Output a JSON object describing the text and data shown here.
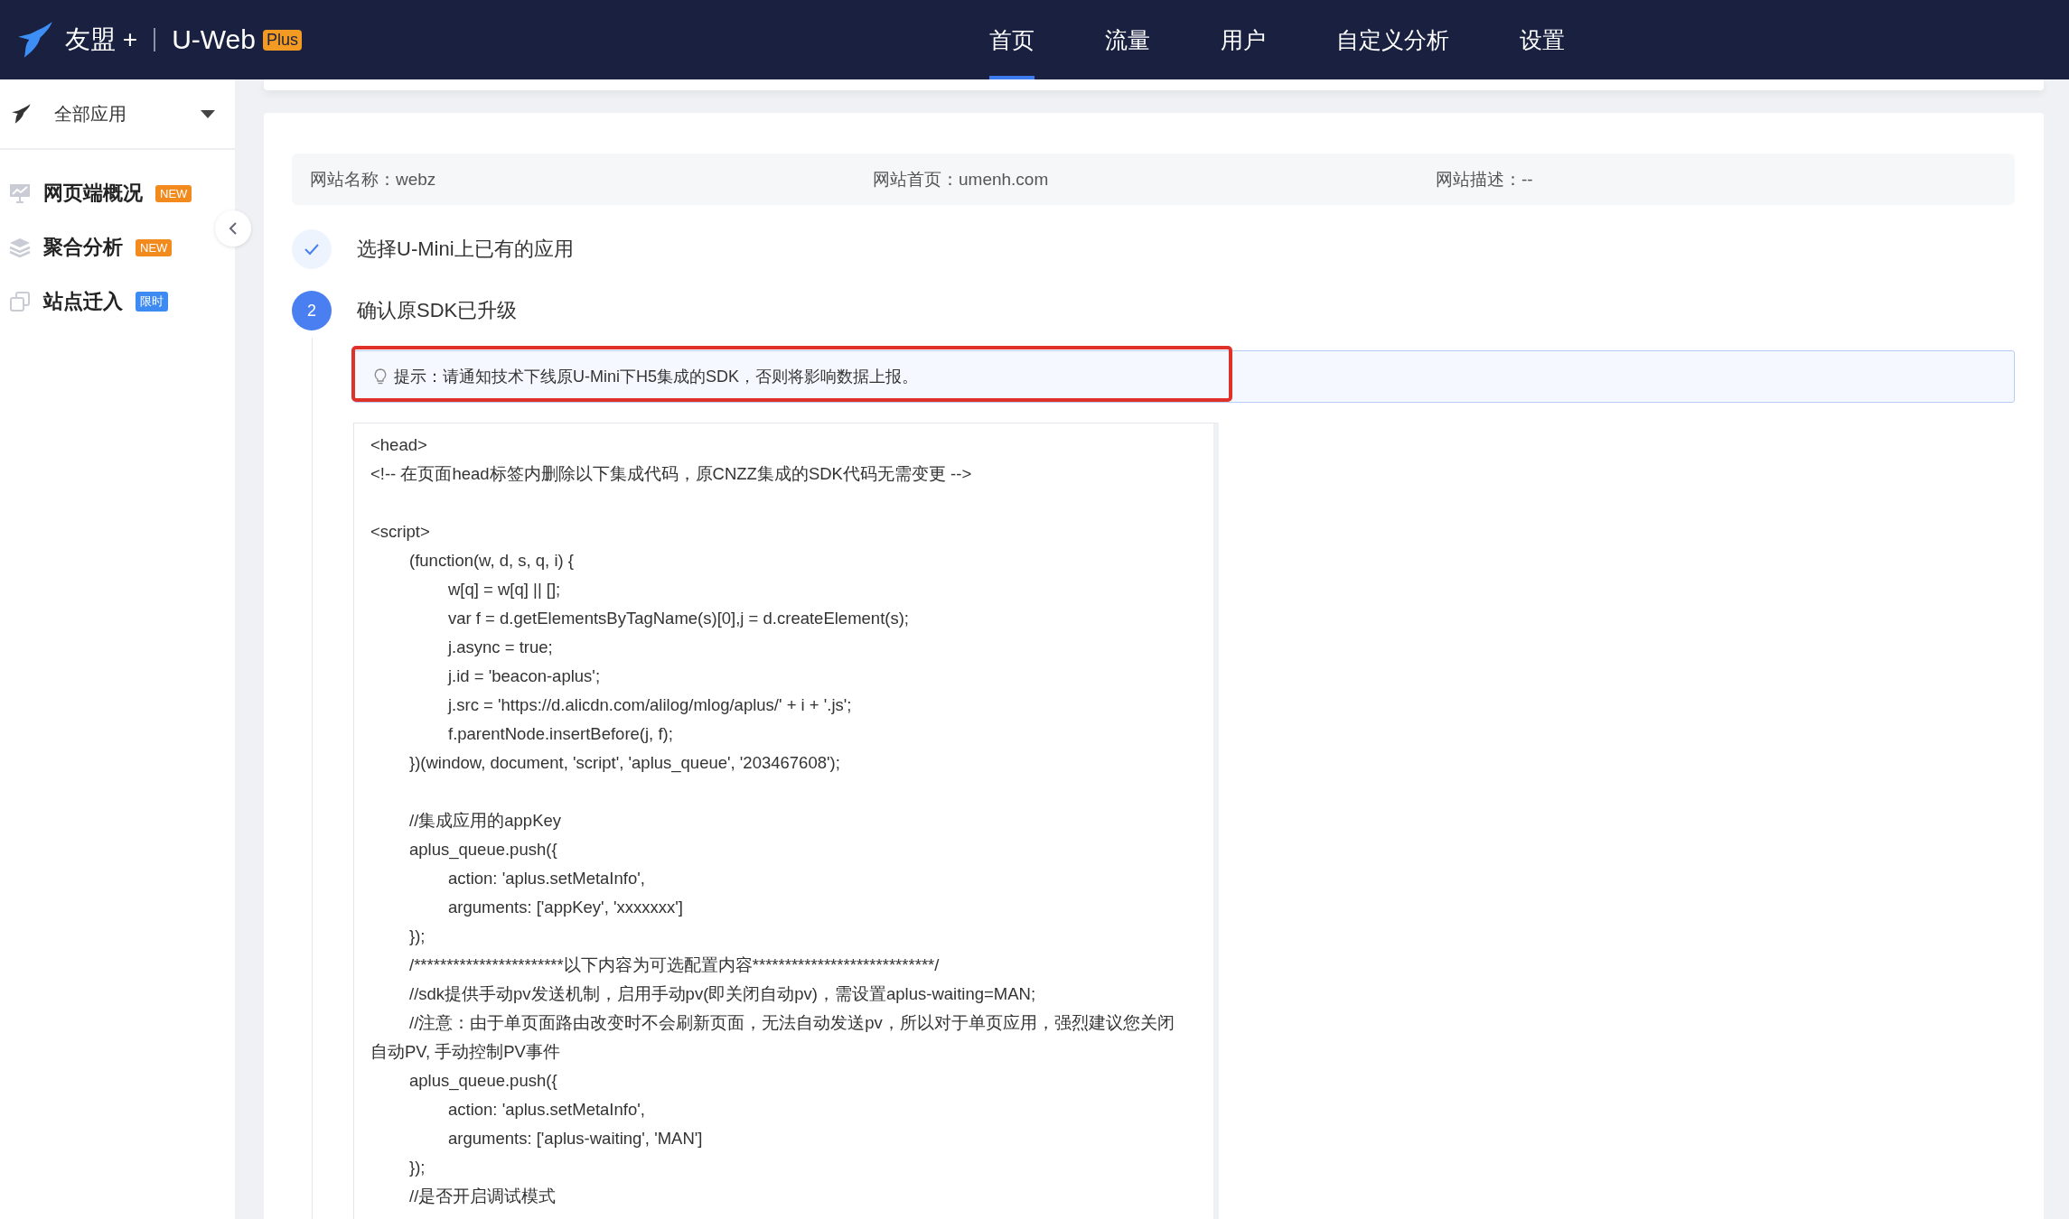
{
  "header": {
    "brand": "友盟 +",
    "product": "U-Web",
    "product_badge": "Plus",
    "nav": [
      {
        "label": "首页",
        "selected": true
      },
      {
        "label": "流量",
        "selected": false
      },
      {
        "label": "用户",
        "selected": false
      },
      {
        "label": "自定义分析",
        "selected": false
      },
      {
        "label": "设置",
        "selected": false
      }
    ]
  },
  "sidebar": {
    "app_selector": "全部应用",
    "items": [
      {
        "label": "网页端概况",
        "badge": {
          "text": "NEW",
          "color": "#f28a1e"
        },
        "kind": "chart"
      },
      {
        "label": "聚合分析",
        "badge": {
          "text": "NEW",
          "color": "#f28a1e"
        },
        "kind": "layers"
      },
      {
        "label": "站点迁入",
        "badge": {
          "text": "限时",
          "color": "#3d8bf2"
        },
        "kind": "copy"
      }
    ]
  },
  "site_info": [
    {
      "label": "网站名称：",
      "value": "webz"
    },
    {
      "label": "网站首页：",
      "value": "umenh.com"
    },
    {
      "label": "网站描述：",
      "value": "--"
    }
  ],
  "steps": [
    {
      "completed": true,
      "title": "选择U-Mini上已有的应用"
    },
    {
      "completed": false,
      "number": "2",
      "title": "确认原SDK已升级"
    }
  ],
  "tip": {
    "text": "提示：请通知技术下线原U-Mini下H5集成的SDK，否则将影响数据上报。",
    "highlighted": true
  },
  "code_lines": [
    {
      "kind": "indent0",
      "text": "<head>"
    },
    {
      "kind": "indent0",
      "text": "<!-- 在页面head标签内删除以下集成代码，原CNZZ集成的SDK代码无需变更 -->"
    },
    {
      "kind": "blank"
    },
    {
      "kind": "indent0",
      "text": "<script>"
    },
    {
      "kind": "indent1",
      "text": "(function(w, d, s, q, i) {"
    },
    {
      "kind": "indent2",
      "text": "w[q] = w[q] || [];"
    },
    {
      "kind": "indent2",
      "text": "var f = d.getElementsByTagName(s)[0],j = d.createElement(s);"
    },
    {
      "kind": "indent2",
      "text": "j.async = true;"
    },
    {
      "kind": "indent2",
      "text": "j.id = 'beacon-aplus';"
    },
    {
      "kind": "indent2",
      "text": "j.src = 'https://d.alicdn.com/alilog/mlog/aplus/' + i + '.js';"
    },
    {
      "kind": "indent2",
      "text": "f.parentNode.insertBefore(j, f);"
    },
    {
      "kind": "indent1",
      "text": "})(window, document, 'script', 'aplus_queue', '203467608');"
    },
    {
      "kind": "blank"
    },
    {
      "kind": "indent1",
      "text": "//集成应用的appKey"
    },
    {
      "kind": "indent1",
      "text": "aplus_queue.push({"
    },
    {
      "kind": "indent2",
      "text": "action: 'aplus.setMetaInfo',"
    },
    {
      "kind": "indent2",
      "text": "arguments: ['appKey', 'xxxxxxx']"
    },
    {
      "kind": "indent1",
      "text": "});"
    },
    {
      "kind": "indent1",
      "text": "/***********************以下内容为可选配置内容****************************/"
    },
    {
      "kind": "indent1",
      "text": "//sdk提供手动pv发送机制，启用手动pv(即关闭自动pv)，需设置aplus-waiting=MAN;"
    },
    {
      "kind": "indent1",
      "text": "//注意：由于单页面路由改变时不会刷新页面，无法自动发送pv，所以对于单页应用，强烈建议您关闭自动PV, 手动控制PV事件"
    },
    {
      "kind": "indent1",
      "text": "aplus_queue.push({"
    },
    {
      "kind": "indent2",
      "text": "action: 'aplus.setMetaInfo',"
    },
    {
      "kind": "indent2",
      "text": "arguments: ['aplus-waiting', 'MAN']"
    },
    {
      "kind": "indent1",
      "text": "});"
    },
    {
      "kind": "indent1",
      "text": "//是否开启调试模式"
    }
  ]
}
